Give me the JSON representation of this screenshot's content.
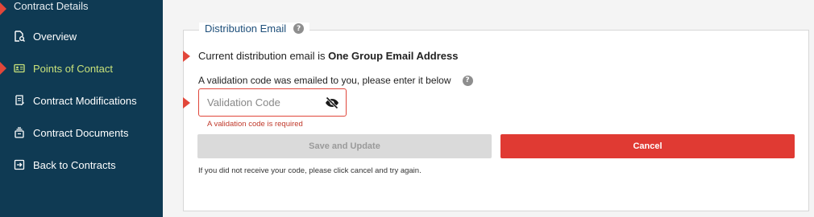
{
  "sidebar": {
    "header": "Contract Details",
    "items": [
      {
        "label": "Overview",
        "icon": "file-search-icon"
      },
      {
        "label": "Points of Contact",
        "icon": "contact-card-icon",
        "active": true
      },
      {
        "label": "Contract Modifications",
        "icon": "document-edit-icon"
      },
      {
        "label": "Contract Documents",
        "icon": "documents-icon"
      },
      {
        "label": "Back to Contracts",
        "icon": "exit-icon"
      }
    ]
  },
  "panel": {
    "legend": "Distribution Email",
    "current_prefix": "Current distribution email is ",
    "current_value": "One Group Email Address",
    "instruction": "A validation code was emailed to you, please enter it below",
    "code_field": {
      "placeholder": "Validation Code",
      "value": ""
    },
    "error": "A validation code is required",
    "save_label": "Save and Update",
    "cancel_label": "Cancel",
    "footnote": "If you did not receive your code, please click cancel and try again."
  },
  "colors": {
    "sidebar_bg": "#0f3a53",
    "accent_marker": "#e2473a",
    "active_text": "#c9e27a",
    "cancel_bg": "#e03a33",
    "legend_text": "#1e4f7a"
  }
}
